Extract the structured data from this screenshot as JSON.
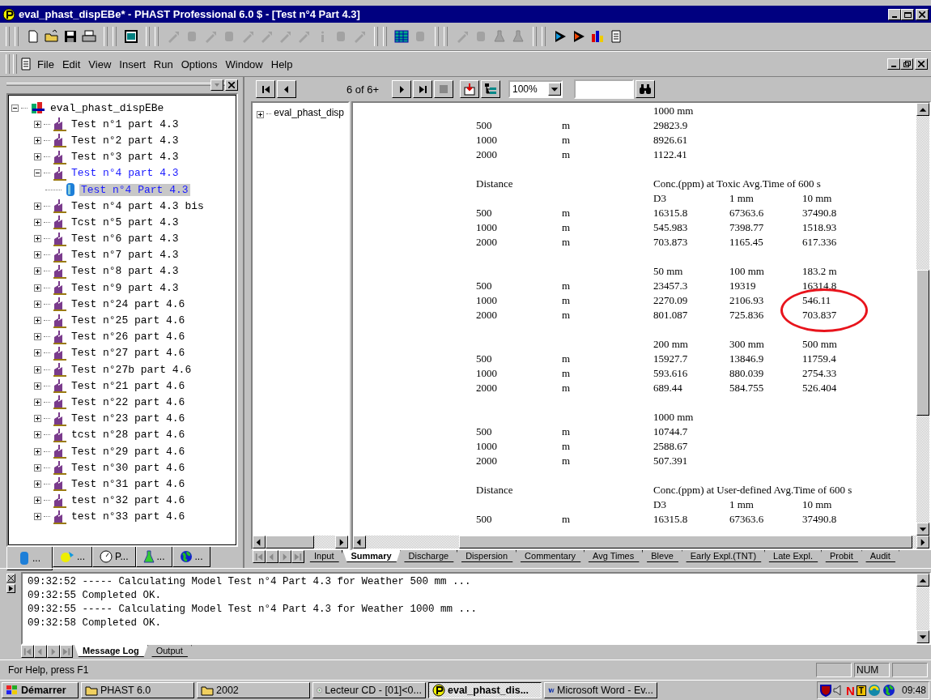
{
  "window": {
    "title": "eval_phast_dispEBe* - PHAST Professional 6.0 $ - [Test n°4 Part 4.3]"
  },
  "toolbar": {
    "groups": [
      [
        {
          "kind": "new",
          "disabled": false
        },
        {
          "kind": "open",
          "disabled": false
        },
        {
          "kind": "save",
          "disabled": false
        },
        {
          "kind": "print",
          "disabled": false
        }
      ],
      [
        {
          "kind": "panel",
          "disabled": false
        }
      ],
      [
        {
          "kind": "tool",
          "disabled": true
        },
        {
          "kind": "block",
          "disabled": true
        },
        {
          "kind": "tool",
          "disabled": true
        },
        {
          "kind": "block",
          "disabled": true
        },
        {
          "kind": "tool",
          "disabled": true
        },
        {
          "kind": "tool",
          "disabled": true
        },
        {
          "kind": "tool",
          "disabled": true
        },
        {
          "kind": "tool",
          "disabled": true
        },
        {
          "kind": "info",
          "disabled": true
        },
        {
          "kind": "block",
          "disabled": true
        },
        {
          "kind": "tool",
          "disabled": true
        }
      ],
      [
        {
          "kind": "grid",
          "disabled": false
        },
        {
          "kind": "block",
          "disabled": true
        }
      ],
      [
        {
          "kind": "tool",
          "disabled": true
        },
        {
          "kind": "block",
          "disabled": true
        },
        {
          "kind": "flask",
          "disabled": true
        },
        {
          "kind": "flask",
          "disabled": true
        }
      ],
      [
        {
          "kind": "play",
          "disabled": false
        },
        {
          "kind": "play-red",
          "disabled": false
        },
        {
          "kind": "bars",
          "disabled": false
        },
        {
          "kind": "sheet",
          "disabled": false
        }
      ]
    ]
  },
  "menu": [
    "File",
    "Edit",
    "View",
    "Insert",
    "Run",
    "Options",
    "Window",
    "Help"
  ],
  "study_tree": {
    "label": "eval_phast_dispEBe",
    "kind": "study",
    "expanded": true,
    "children": [
      {
        "label": "Test n°1 part 4.3",
        "expanded": false,
        "current": false
      },
      {
        "label": "Test n°2 part 4.3",
        "expanded": false,
        "current": false
      },
      {
        "label": "Test n°3 part 4.3",
        "expanded": false,
        "current": false
      },
      {
        "label": "Test n°4 part 4.3",
        "expanded": true,
        "current": true,
        "children": [
          {
            "label": "Test n°4 Part 4.3",
            "selected": true
          }
        ]
      },
      {
        "label": "Test n°4 part 4.3 bis",
        "expanded": false,
        "current": false
      },
      {
        "label": "Tcst n°5 part 4.3",
        "expanded": false,
        "current": false
      },
      {
        "label": "Test n°6 part 4.3",
        "expanded": false,
        "current": false
      },
      {
        "label": "Test n°7 part 4.3",
        "expanded": false,
        "current": false
      },
      {
        "label": "Test n°8 part 4.3",
        "expanded": false,
        "current": false
      },
      {
        "label": "Test n°9 part 4.3",
        "expanded": false,
        "current": false
      },
      {
        "label": "Test n°24 part 4.6",
        "expanded": false,
        "current": false
      },
      {
        "label": "Test n°25 part 4.6",
        "expanded": false,
        "current": false
      },
      {
        "label": "Test n°26 part 4.6",
        "expanded": false,
        "current": false
      },
      {
        "label": "Test n°27 part 4.6",
        "expanded": false,
        "current": false
      },
      {
        "label": "Test n°27b part 4.6",
        "expanded": false,
        "current": false
      },
      {
        "label": "Test n°21 part 4.6",
        "expanded": false,
        "current": false
      },
      {
        "label": "Test n°22 part 4.6",
        "expanded": false,
        "current": false
      },
      {
        "label": "Test n°23 part 4.6",
        "expanded": false,
        "current": false
      },
      {
        "label": "tcst n°28 part 4.6",
        "expanded": false,
        "current": false
      },
      {
        "label": "Test n°29 part 4.6",
        "expanded": false,
        "current": false
      },
      {
        "label": "Test n°30 part 4.6",
        "expanded": false,
        "current": false
      },
      {
        "label": "Test n°31 part 4.6",
        "expanded": false,
        "current": false
      },
      {
        "label": "test n°32 part 4.6",
        "expanded": false,
        "current": false
      },
      {
        "label": "test n°33 part 4.6",
        "expanded": false,
        "current": false
      }
    ]
  },
  "panel_tabs": [
    {
      "kind": "tank",
      "label": "...",
      "selected": true
    },
    {
      "kind": "splash",
      "label": "...",
      "selected": false
    },
    {
      "kind": "gauge",
      "label": "P...",
      "selected": false
    },
    {
      "kind": "flask",
      "label": "...",
      "selected": false
    },
    {
      "kind": "globe",
      "label": "...",
      "selected": false
    }
  ],
  "report_nav": {
    "page": "6 of 6+",
    "zoom": "100%"
  },
  "side_tree": {
    "label": "eval_phast_disp",
    "expanded": false
  },
  "report": {
    "blocks": [
      {
        "columns": [
          "1000 mm"
        ],
        "rows": [
          {
            "distance": "500",
            "unit": "m",
            "values": [
              "29823.9"
            ]
          },
          {
            "distance": "1000",
            "unit": "m",
            "values": [
              "8926.61"
            ]
          },
          {
            "distance": "2000",
            "unit": "m",
            "values": [
              "1122.41"
            ]
          }
        ]
      },
      {
        "heading": {
          "label": "Distance",
          "text": "Conc.(ppm) at Toxic Avg.Time of 600 s"
        },
        "columns": [
          "D3",
          "1 mm",
          "10 mm"
        ],
        "rows": [
          {
            "distance": "500",
            "unit": "m",
            "values": [
              "16315.8",
              "67363.6",
              "37490.8"
            ]
          },
          {
            "distance": "1000",
            "unit": "m",
            "values": [
              "545.983",
              "7398.77",
              "1518.93"
            ]
          },
          {
            "distance": "2000",
            "unit": "m",
            "values": [
              "703.873",
              "1165.45",
              "617.336"
            ]
          }
        ]
      },
      {
        "columns": [
          "50 mm",
          "100 mm",
          "183.2 m"
        ],
        "rows": [
          {
            "distance": "500",
            "unit": "m",
            "values": [
              "23457.3",
              "19319",
              "16314.8"
            ]
          },
          {
            "distance": "1000",
            "unit": "m",
            "values": [
              "2270.09",
              "2106.93",
              "546.11"
            ]
          },
          {
            "distance": "2000",
            "unit": "m",
            "values": [
              "801.087",
              "725.836",
              "703.837"
            ]
          }
        ]
      },
      {
        "columns": [
          "200 mm",
          "300 mm",
          "500 mm"
        ],
        "rows": [
          {
            "distance": "500",
            "unit": "m",
            "values": [
              "15927.7",
              "13846.9",
              "11759.4"
            ]
          },
          {
            "distance": "1000",
            "unit": "m",
            "values": [
              "593.616",
              "880.039",
              "2754.33"
            ]
          },
          {
            "distance": "2000",
            "unit": "m",
            "values": [
              "689.44",
              "584.755",
              "526.404"
            ]
          }
        ]
      },
      {
        "columns": [
          "1000 mm"
        ],
        "rows": [
          {
            "distance": "500",
            "unit": "m",
            "values": [
              "10744.7"
            ]
          },
          {
            "distance": "1000",
            "unit": "m",
            "values": [
              "2588.67"
            ]
          },
          {
            "distance": "2000",
            "unit": "m",
            "values": [
              "507.391"
            ]
          }
        ]
      },
      {
        "heading": {
          "label": "Distance",
          "text": "Conc.(ppm) at User-defined Avg.Time of 600 s"
        },
        "columns": [
          "D3",
          "1 mm",
          "10 mm"
        ],
        "rows": [
          {
            "distance": "500",
            "unit": "m",
            "values": [
              "16315.8",
              "67363.6",
              "37490.8"
            ]
          }
        ]
      }
    ],
    "annotation": {
      "color": "#e8141c"
    }
  },
  "report_tabs": [
    {
      "label": "Input",
      "selected": false
    },
    {
      "label": "Summary",
      "selected": true
    },
    {
      "label": "Discharge",
      "selected": false
    },
    {
      "label": "Dispersion",
      "selected": false
    },
    {
      "label": "Commentary",
      "selected": false
    },
    {
      "label": "Avg Times",
      "selected": false
    },
    {
      "label": "Bleve",
      "selected": false
    },
    {
      "label": "Early Expl.(TNT)",
      "selected": false
    },
    {
      "label": "Late Expl.",
      "selected": false
    },
    {
      "label": "Probit",
      "selected": false
    },
    {
      "label": "Audit",
      "selected": false
    }
  ],
  "log": {
    "lines": [
      "09:32:52 ----- Calculating Model Test n°4 Part 4.3 for Weather 500 mm ...",
      "09:32:55 Completed OK.",
      "09:32:55 ----- Calculating Model Test n°4 Part 4.3 for Weather 1000 mm ...",
      "09:32:58 Completed OK."
    ],
    "tabs": [
      {
        "label": "Message Log",
        "selected": true
      },
      {
        "label": "Output",
        "selected": false
      }
    ]
  },
  "status_bar": {
    "text": "For Help, press F1",
    "indicators": [
      "NUM"
    ]
  },
  "taskbar": {
    "start": "Démarrer",
    "tasks": [
      {
        "kind": "folder",
        "label": "PHAST 6.0",
        "selected": false
      },
      {
        "kind": "folder",
        "label": "2002",
        "selected": false
      },
      {
        "kind": "cd",
        "label": "Lecteur CD - [01]<0...",
        "selected": false
      },
      {
        "kind": "phast",
        "label": "eval_phast_dis...",
        "selected": true
      },
      {
        "kind": "word",
        "label": "Microsoft Word - Ev...",
        "selected": false
      }
    ],
    "tray": [
      {
        "kind": "shield"
      },
      {
        "kind": "speaker"
      },
      {
        "kind": "glyph",
        "text": "N"
      },
      {
        "kind": "badge",
        "text": "T"
      },
      {
        "kind": "swirl"
      },
      {
        "kind": "globe"
      }
    ],
    "clock": "09:48"
  }
}
